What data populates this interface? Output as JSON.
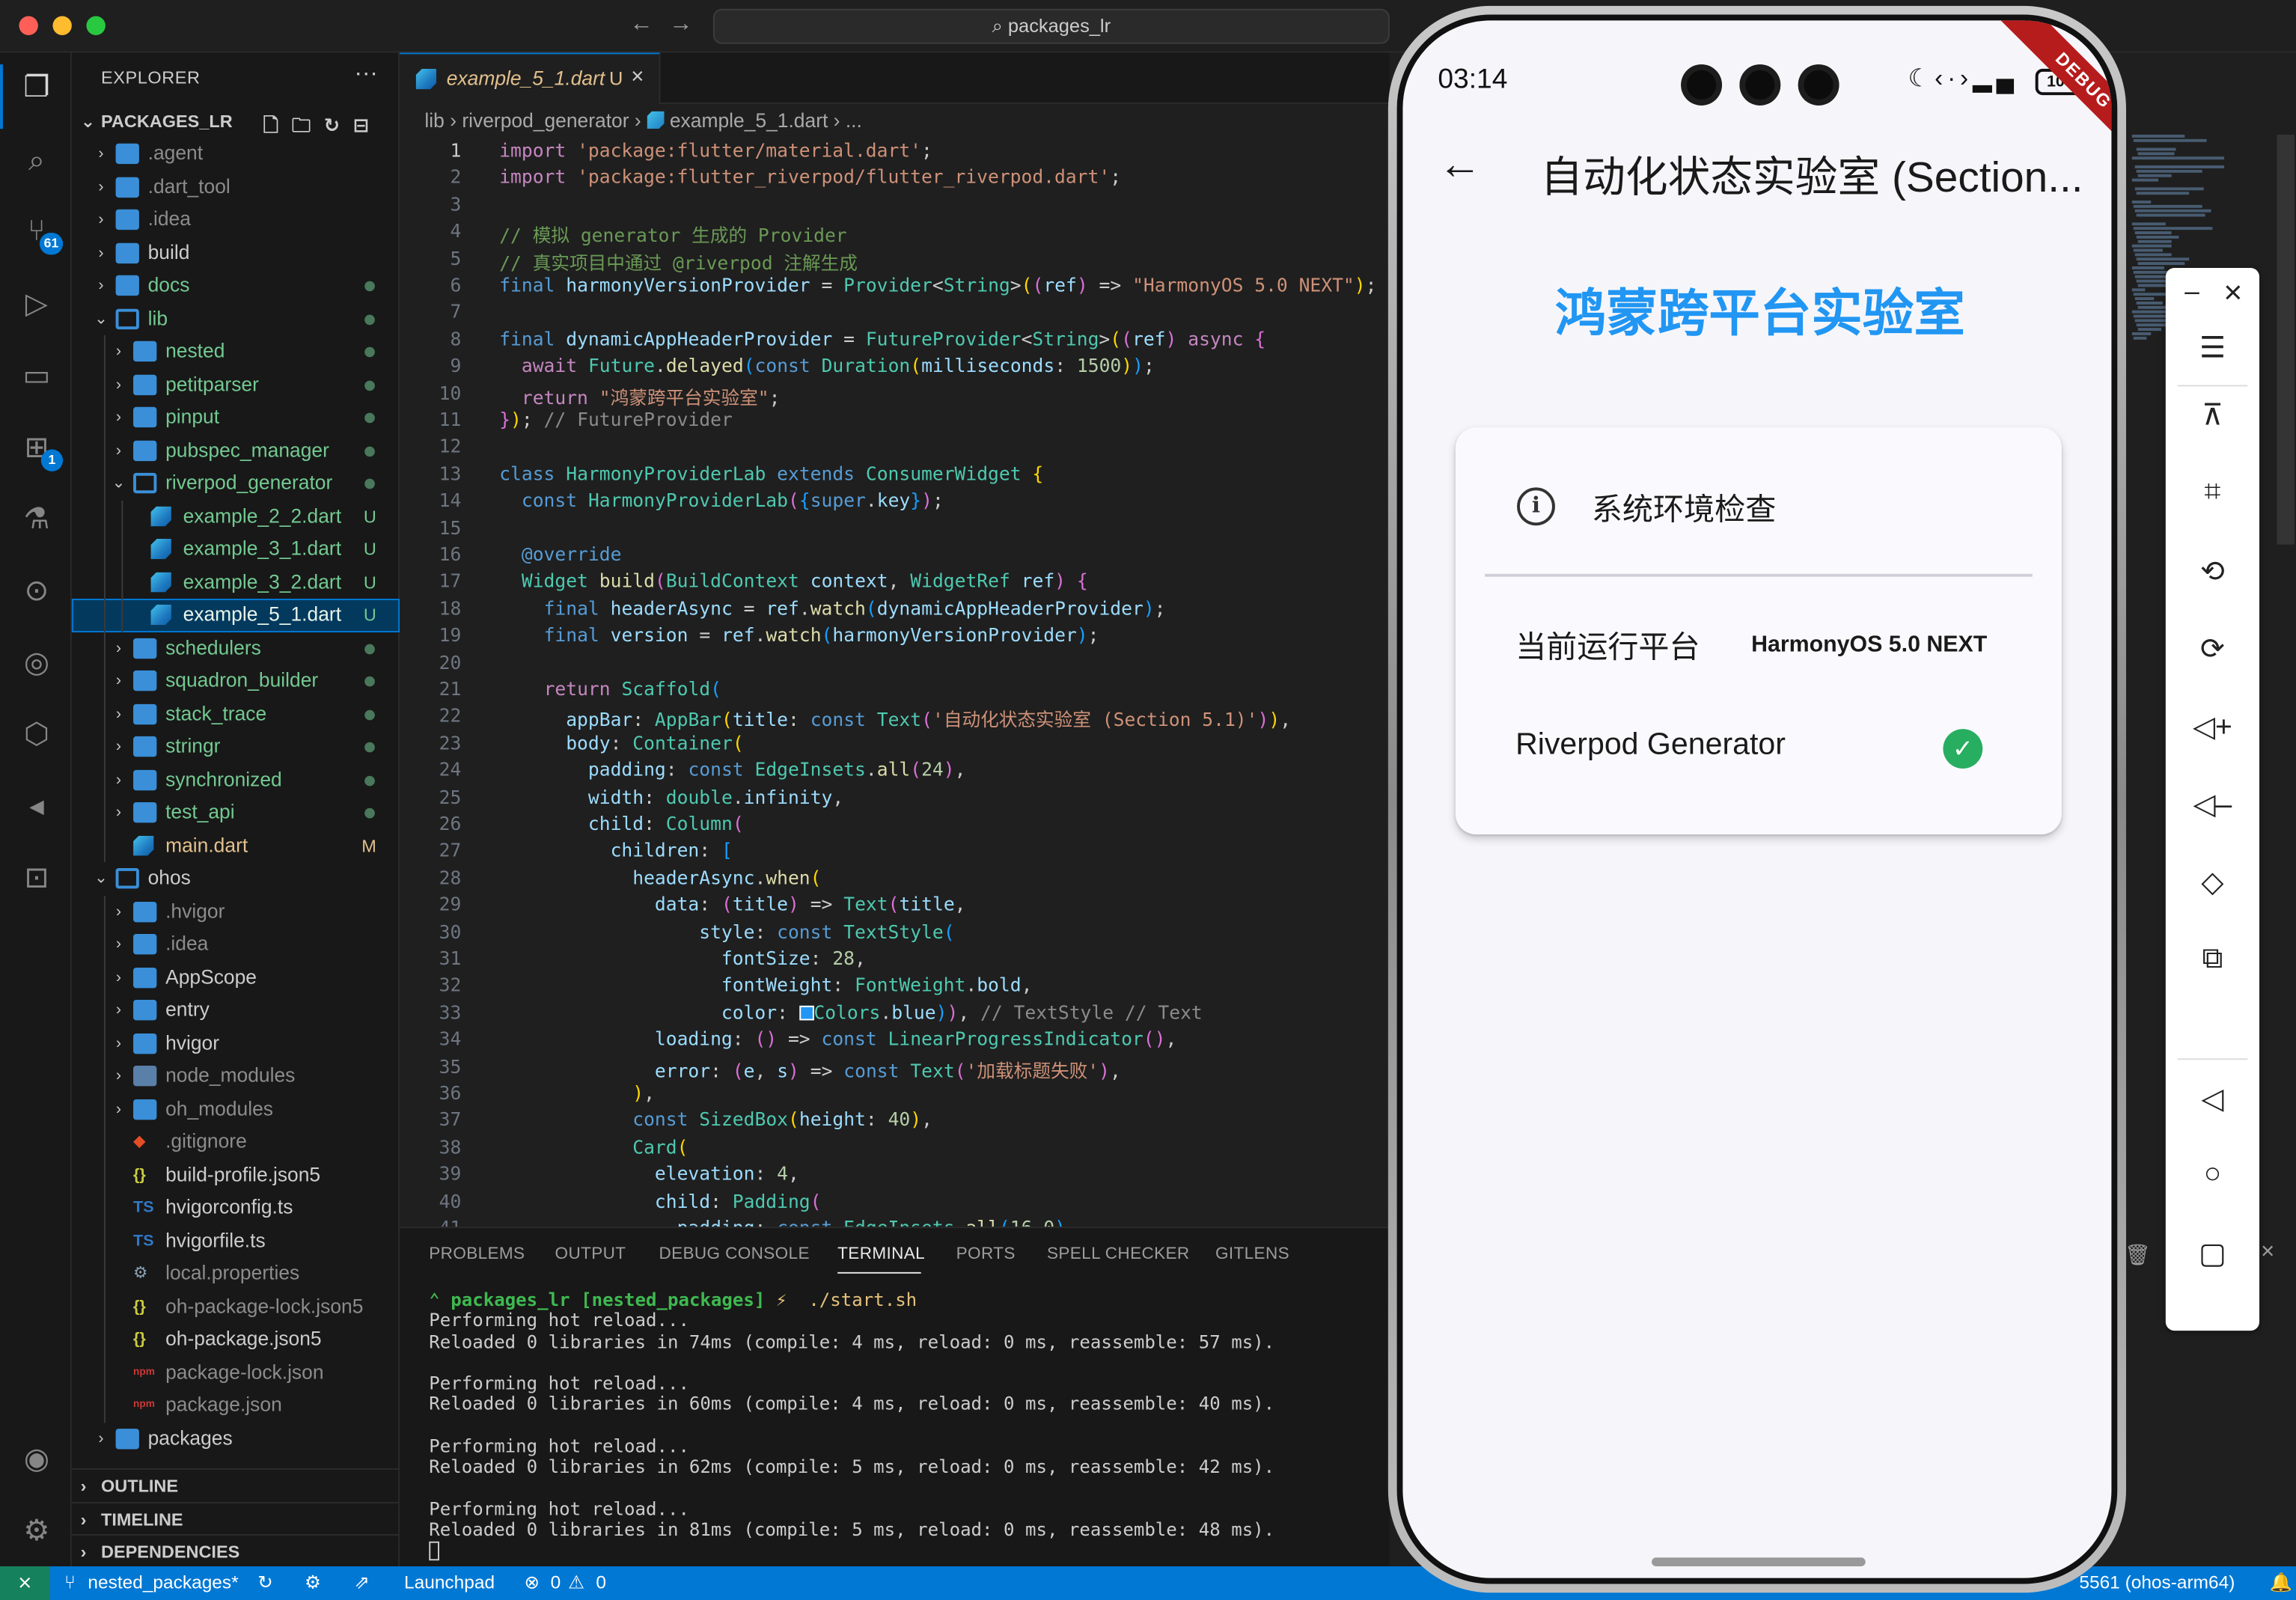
{
  "window": {
    "command_center": "packages_lr"
  },
  "activity_bar": {
    "source_control_badge": "61",
    "extensions_badge": "1"
  },
  "explorer": {
    "header": "EXPLORER",
    "more": "···",
    "root": "PACKAGES_LR",
    "items": [
      {
        "label": ".agent",
        "kind": "folder",
        "depth": 1,
        "status": ""
      },
      {
        "label": ".dart_tool",
        "kind": "folder",
        "depth": 1,
        "status": ""
      },
      {
        "label": ".idea",
        "kind": "folder",
        "depth": 1,
        "status": ""
      },
      {
        "label": "build",
        "kind": "folder",
        "depth": 1,
        "status": ""
      },
      {
        "label": "docs",
        "kind": "folder",
        "depth": 1,
        "status": "dot"
      },
      {
        "label": "lib",
        "kind": "folder-open",
        "depth": 1,
        "status": "dot"
      },
      {
        "label": "nested",
        "kind": "folder",
        "depth": 2,
        "status": "dot"
      },
      {
        "label": "petitparser",
        "kind": "folder",
        "depth": 2,
        "status": "dot"
      },
      {
        "label": "pinput",
        "kind": "folder",
        "depth": 2,
        "status": "dot"
      },
      {
        "label": "pubspec_manager",
        "kind": "folder",
        "depth": 2,
        "status": "dot"
      },
      {
        "label": "riverpod_generator",
        "kind": "folder-open",
        "depth": 2,
        "status": "dot"
      },
      {
        "label": "example_2_2.dart",
        "kind": "dart",
        "depth": 3,
        "status": "U"
      },
      {
        "label": "example_3_1.dart",
        "kind": "dart",
        "depth": 3,
        "status": "U"
      },
      {
        "label": "example_3_2.dart",
        "kind": "dart",
        "depth": 3,
        "status": "U"
      },
      {
        "label": "example_5_1.dart",
        "kind": "dart",
        "depth": 3,
        "status": "U",
        "selected": true
      },
      {
        "label": "schedulers",
        "kind": "folder",
        "depth": 2,
        "status": "dot"
      },
      {
        "label": "squadron_builder",
        "kind": "folder",
        "depth": 2,
        "status": "dot"
      },
      {
        "label": "stack_trace",
        "kind": "folder",
        "depth": 2,
        "status": "dot"
      },
      {
        "label": "stringr",
        "kind": "folder",
        "depth": 2,
        "status": "dot"
      },
      {
        "label": "synchronized",
        "kind": "folder",
        "depth": 2,
        "status": "dot"
      },
      {
        "label": "test_api",
        "kind": "folder",
        "depth": 2,
        "status": "dot"
      },
      {
        "label": "main.dart",
        "kind": "dart",
        "depth": 2,
        "status": "M"
      },
      {
        "label": "ohos",
        "kind": "folder-open",
        "depth": 1,
        "status": ""
      },
      {
        "label": ".hvigor",
        "kind": "folder",
        "depth": 2,
        "status": ""
      },
      {
        "label": ".idea",
        "kind": "folder",
        "depth": 2,
        "status": ""
      },
      {
        "label": "AppScope",
        "kind": "folder",
        "depth": 2,
        "status": ""
      },
      {
        "label": "entry",
        "kind": "folder",
        "depth": 2,
        "status": ""
      },
      {
        "label": "hvigor",
        "kind": "folder",
        "depth": 2,
        "status": ""
      },
      {
        "label": "node_modules",
        "kind": "folder-node",
        "depth": 2,
        "status": ""
      },
      {
        "label": "oh_modules",
        "kind": "folder",
        "depth": 2,
        "status": ""
      },
      {
        "label": ".gitignore",
        "kind": "git",
        "depth": 2,
        "status": ""
      },
      {
        "label": "build-profile.json5",
        "kind": "json",
        "depth": 2,
        "status": ""
      },
      {
        "label": "hvigorconfig.ts",
        "kind": "ts",
        "depth": 2,
        "status": ""
      },
      {
        "label": "hvigorfile.ts",
        "kind": "ts",
        "depth": 2,
        "status": ""
      },
      {
        "label": "local.properties",
        "kind": "gear",
        "depth": 2,
        "status": ""
      },
      {
        "label": "oh-package-lock.json5",
        "kind": "json",
        "depth": 2,
        "status": ""
      },
      {
        "label": "oh-package.json5",
        "kind": "json",
        "depth": 2,
        "status": ""
      },
      {
        "label": "package-lock.json",
        "kind": "npm",
        "depth": 2,
        "status": ""
      },
      {
        "label": "package.json",
        "kind": "npm",
        "depth": 2,
        "status": ""
      },
      {
        "label": "packages",
        "kind": "folder",
        "depth": 1,
        "status": ""
      }
    ],
    "sections": [
      "OUTLINE",
      "TIMELINE",
      "DEPENDENCIES"
    ]
  },
  "editor": {
    "tab": {
      "title": "example_5_1.dart",
      "status": "U"
    },
    "breadcrumb": [
      "lib",
      "riverpod_generator",
      "example_5_1.dart",
      "..."
    ],
    "current_line": 1
  },
  "panel": {
    "tabs": [
      "PROBLEMS",
      "OUTPUT",
      "DEBUG CONSOLE",
      "TERMINAL",
      "PORTS",
      "SPELL CHECKER",
      "GITLENS"
    ],
    "active_tab": "TERMINAL",
    "terminal": {
      "prompt_dir": "packages_lr",
      "prompt_branch": "[nested_packages]",
      "prompt_symbol": "⚡",
      "command": "./start.sh",
      "lines": [
        "Performing hot reload...",
        "Reloaded 0 libraries in 74ms (compile: 4 ms, reload: 0 ms, reassemble: 57 ms).",
        "",
        "Performing hot reload...",
        "Reloaded 0 libraries in 60ms (compile: 4 ms, reload: 0 ms, reassemble: 40 ms).",
        "",
        "Performing hot reload...",
        "Reloaded 0 libraries in 62ms (compile: 5 ms, reload: 0 ms, reassemble: 42 ms).",
        "",
        "Performing hot reload...",
        "Reloaded 0 libraries in 81ms (compile: 5 ms, reload: 0 ms, reassemble: 48 ms)."
      ]
    }
  },
  "status_bar": {
    "branch": "nested_packages*",
    "launchpad": "Launchpad",
    "errors": "0",
    "warnings": "0",
    "device": "5561 (ohos-arm64)"
  },
  "phone": {
    "time": "03:14",
    "battery": "100",
    "debug_banner": "DEBUG",
    "appbar_title": "自动化状态实验室 (Section...",
    "headline": "鸿蒙跨平台实验室",
    "card": {
      "title": "系统环境检查",
      "platform_label": "当前运行平台",
      "platform_value": "HarmonyOS 5.0 NEXT",
      "generator_label": "Riverpod Generator"
    },
    "colors": {
      "headline": "#2196f3",
      "check": "#27ae60"
    }
  },
  "emulator_toolbar": {
    "items": [
      "minimize-icon",
      "close-icon",
      "menu-icon",
      "pin-icon",
      "crop-icon",
      "rotate-left-icon",
      "rotate-right-icon",
      "volume-up-icon",
      "volume-down-icon",
      "fold-icon",
      "screenshot-icon",
      "back-icon",
      "home-icon",
      "recents-icon"
    ]
  }
}
